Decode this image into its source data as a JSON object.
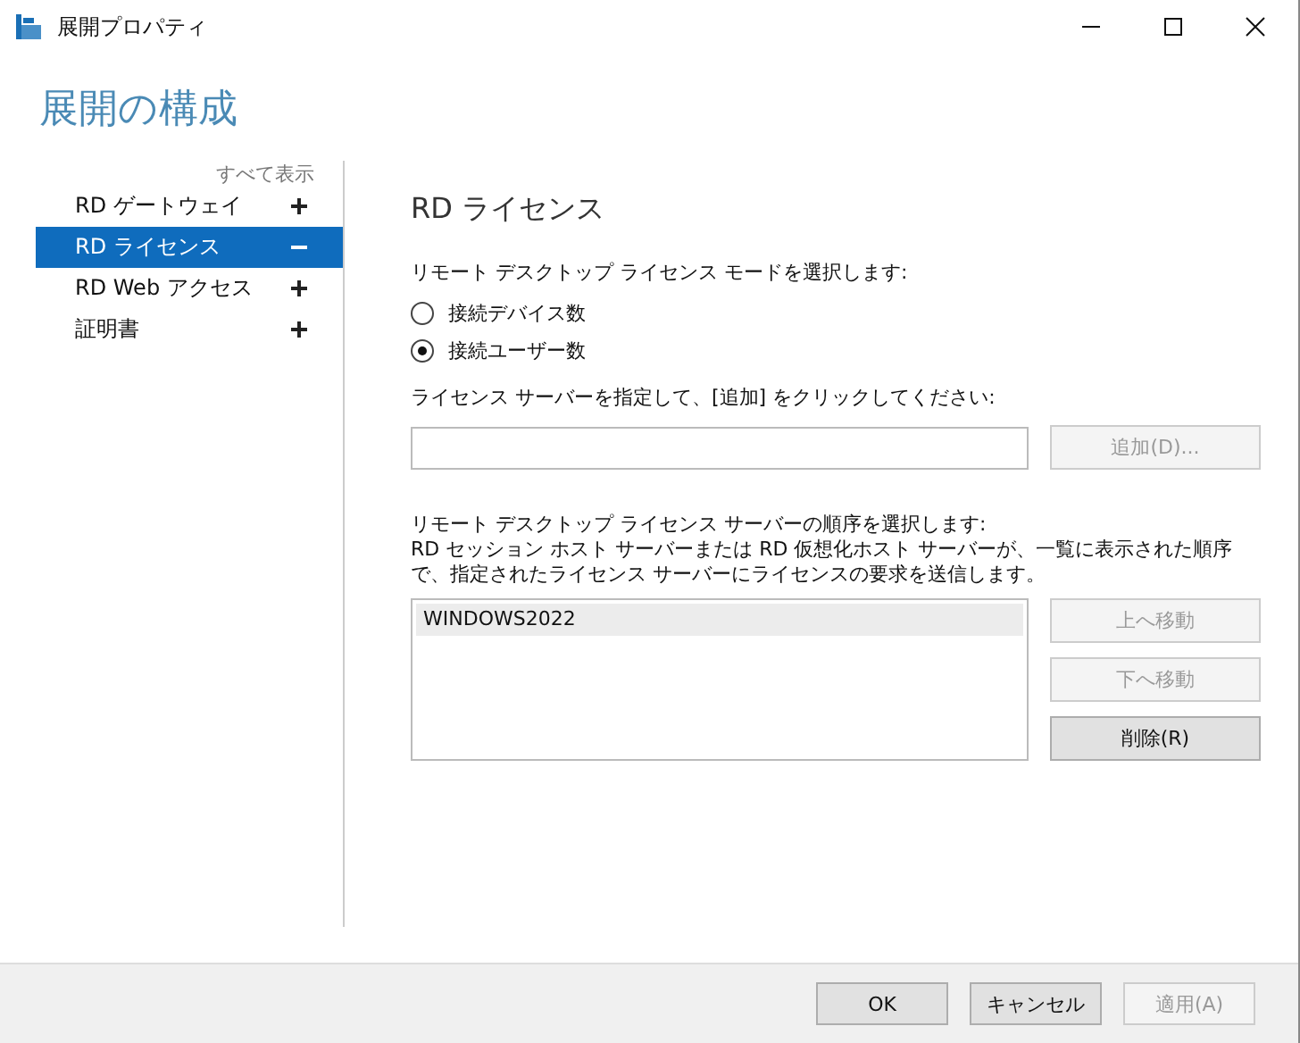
{
  "window": {
    "title": "展開プロパティ"
  },
  "heading": "展開の構成",
  "sidebar": {
    "show_all": "すべて表示",
    "items": [
      {
        "label": "RD ゲートウェイ",
        "selected": false,
        "expanded": false
      },
      {
        "label": "RD ライセンス",
        "selected": true,
        "expanded": true
      },
      {
        "label": "RD Web アクセス",
        "selected": false,
        "expanded": false
      },
      {
        "label": "証明書",
        "selected": false,
        "expanded": false
      }
    ]
  },
  "content": {
    "title": "RD ライセンス",
    "mode_label": "リモート デスクトップ ライセンス モードを選択します:",
    "modes": [
      {
        "label": "接続デバイス数",
        "selected": false
      },
      {
        "label": "接続ユーザー数",
        "selected": true
      }
    ],
    "server_label": "ライセンス サーバーを指定して、[追加] をクリックしてください:",
    "add_button": {
      "label": "追加(D)...",
      "disabled": true
    },
    "order_label": "リモート デスクトップ ライセンス サーバーの順序を選択します:",
    "order_description": "RD セッション ホスト サーバーまたは RD 仮想化ホスト サーバーが、一覧に表示された順序で、指定されたライセンス サーバーにライセンスの要求を送信します。",
    "servers": [
      {
        "name": "WINDOWS2022",
        "selected": true
      }
    ],
    "list_buttons": [
      {
        "label": "上へ移動",
        "disabled": true
      },
      {
        "label": "下へ移動",
        "disabled": true
      },
      {
        "label": "削除(R)",
        "disabled": false
      }
    ]
  },
  "footer_buttons": [
    {
      "label": "OK",
      "disabled": false
    },
    {
      "label": "キャンセル",
      "disabled": false
    },
    {
      "label": "適用(A)",
      "disabled": true
    }
  ]
}
